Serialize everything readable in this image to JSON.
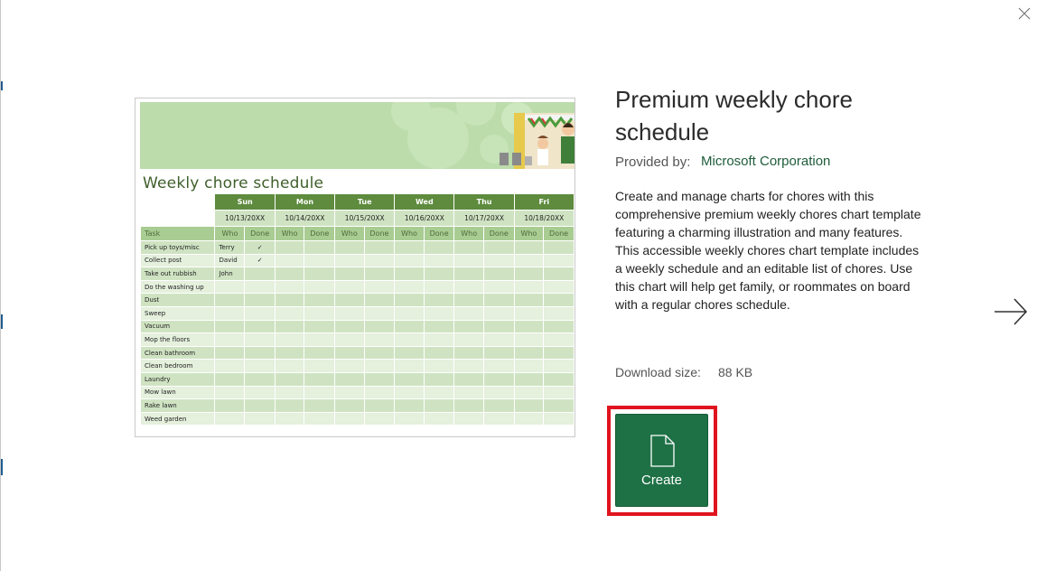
{
  "colors": {
    "accent": "#1e7145",
    "highlight": "#e0141e",
    "day_header": "#5e8b3e"
  },
  "icons": {
    "close": "close-icon",
    "next": "arrow-right-icon",
    "create": "document-icon"
  },
  "template": {
    "title": "Premium weekly chore schedule",
    "provided_by_label": "Provided by:",
    "provider": "Microsoft Corporation",
    "description": "Create and manage charts for chores with this comprehensive premium weekly chores chart template featuring a charming illustration and many features. This accessible weekly chores chart template includes a weekly schedule and an editable list of chores. Use this chart will help get family, or roommates on board with a regular chores schedule.",
    "download_size_label": "Download size:",
    "download_size": "88 KB",
    "create_label": "Create"
  },
  "preview": {
    "sheet_title": "Weekly chore schedule",
    "days": [
      {
        "name": "Sun",
        "date": "10/13/20XX"
      },
      {
        "name": "Mon",
        "date": "10/14/20XX"
      },
      {
        "name": "Tue",
        "date": "10/15/20XX"
      },
      {
        "name": "Wed",
        "date": "10/16/20XX"
      },
      {
        "name": "Thu",
        "date": "10/17/20XX"
      },
      {
        "name": "Fri",
        "date": "10/18/20XX"
      }
    ],
    "task_header": "Task",
    "who_header": "Who",
    "done_header": "Done",
    "tasks": [
      {
        "task": "Pick up toys/misc",
        "who": "Terry",
        "done": "✓"
      },
      {
        "task": "Collect post",
        "who": "David",
        "done": "✓"
      },
      {
        "task": "Take out rubbish",
        "who": "John",
        "done": ""
      },
      {
        "task": "Do the washing up",
        "who": "",
        "done": ""
      },
      {
        "task": "Dust",
        "who": "",
        "done": ""
      },
      {
        "task": "Sweep",
        "who": "",
        "done": ""
      },
      {
        "task": "Vacuum",
        "who": "",
        "done": ""
      },
      {
        "task": "Mop the floors",
        "who": "",
        "done": ""
      },
      {
        "task": "Clean bathroom",
        "who": "",
        "done": ""
      },
      {
        "task": "Clean bedroom",
        "who": "",
        "done": ""
      },
      {
        "task": "Laundry",
        "who": "",
        "done": ""
      },
      {
        "task": "Mow lawn",
        "who": "",
        "done": ""
      },
      {
        "task": "Rake lawn",
        "who": "",
        "done": ""
      },
      {
        "task": "Weed garden",
        "who": "",
        "done": ""
      }
    ]
  }
}
